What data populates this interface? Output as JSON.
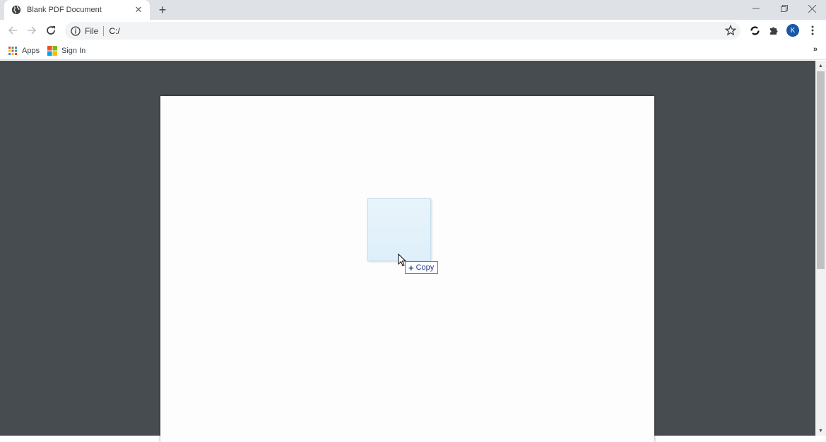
{
  "browser": {
    "tab": {
      "title": "Blank PDF Document",
      "favicon": "globe-icon"
    },
    "new_tab_label": "+",
    "window_controls": {
      "minimize": "minimize-icon",
      "restore": "restore-icon",
      "close": "close-icon"
    },
    "omnibox": {
      "scheme_label": "File",
      "url": "C:/"
    },
    "profile_initial": "K",
    "bookmarks": [
      {
        "label": "Apps",
        "icon": "apps-grid-icon"
      },
      {
        "label": "Sign In",
        "icon": "microsoft-logo-icon"
      }
    ],
    "bookmarks_overflow": "»"
  },
  "drag_feedback": {
    "tooltip_plus": "+",
    "tooltip_label": "Copy"
  },
  "colors": {
    "viewer_background": "#474c50",
    "avatar": "#1a56a7",
    "copy_text": "#1f3f8f"
  }
}
